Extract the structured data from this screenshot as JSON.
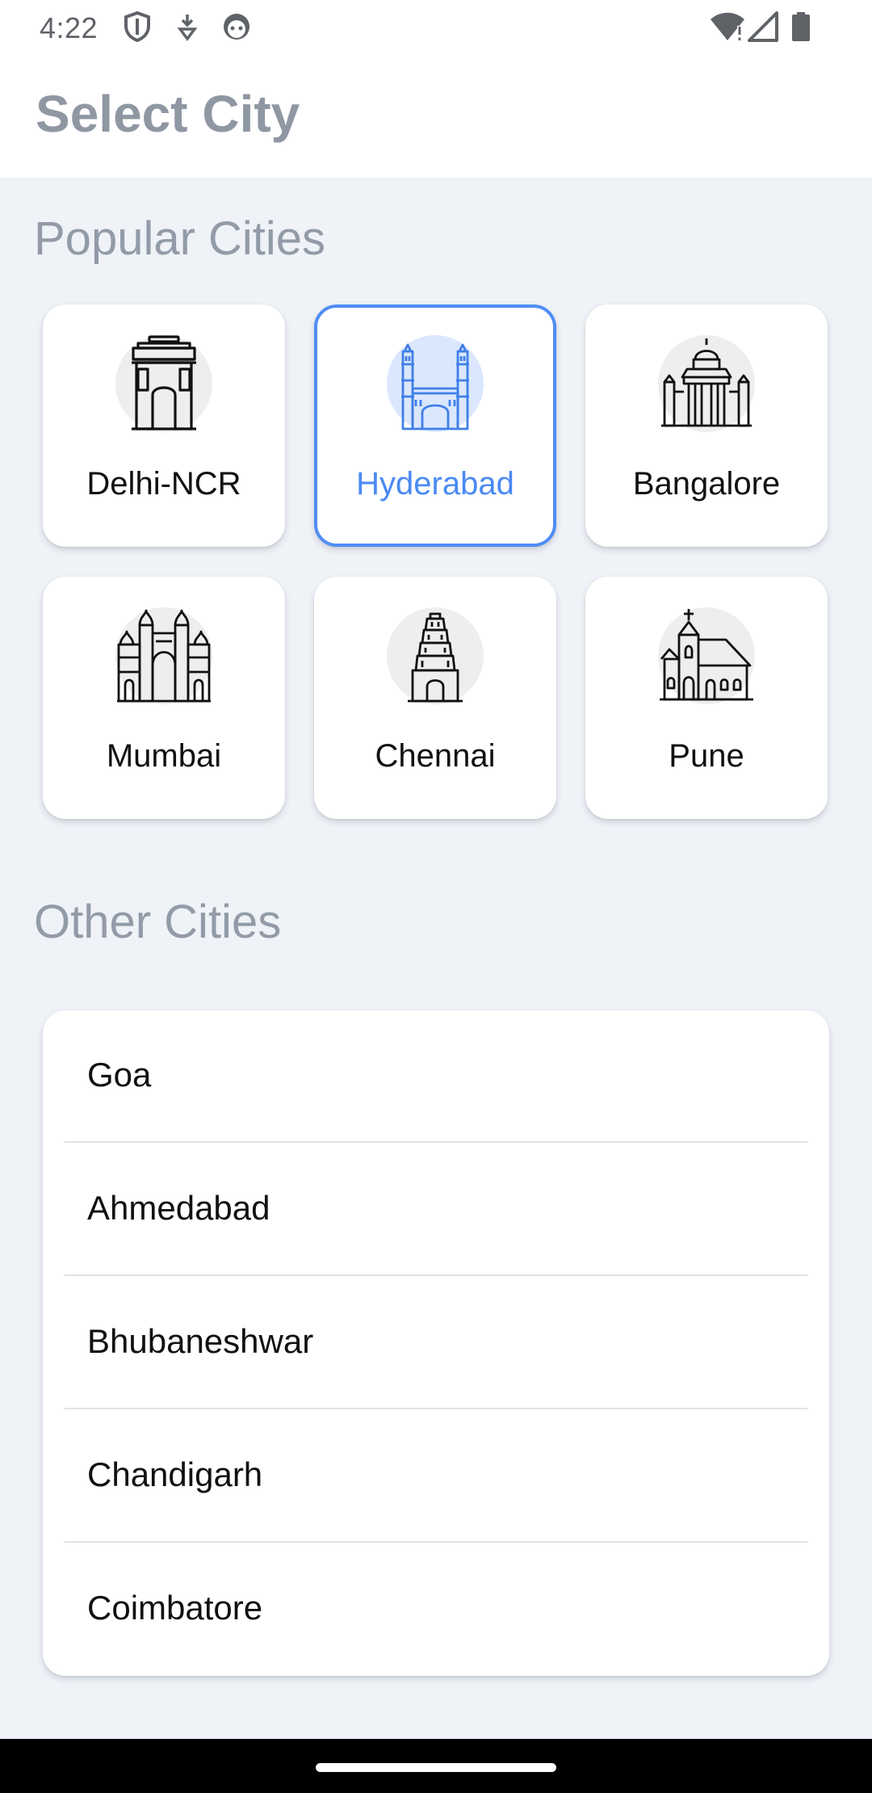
{
  "status_bar": {
    "time": "4:22",
    "left_icons": [
      "shield-icon",
      "download-icon",
      "face-icon"
    ],
    "right_icons": [
      "wifi-alert-icon",
      "signal-icon",
      "battery-icon"
    ]
  },
  "header": {
    "title": "Select City"
  },
  "popular": {
    "title": "Popular Cities",
    "cities": [
      {
        "label": "Delhi-NCR",
        "icon": "india-gate-icon",
        "selected": false
      },
      {
        "label": "Hyderabad",
        "icon": "charminar-icon",
        "selected": true
      },
      {
        "label": "Bangalore",
        "icon": "vidhana-soudha-icon",
        "selected": false
      },
      {
        "label": "Mumbai",
        "icon": "gateway-of-india-icon",
        "selected": false
      },
      {
        "label": "Chennai",
        "icon": "temple-gopuram-icon",
        "selected": false
      },
      {
        "label": "Pune",
        "icon": "church-icon",
        "selected": false
      }
    ]
  },
  "other": {
    "title": "Other Cities",
    "cities": [
      "Goa",
      "Ahmedabad",
      "Bhubaneshwar",
      "Chandigarh",
      "Coimbatore"
    ]
  },
  "colors": {
    "accent": "#4a8af4",
    "selected_icon_bg": "#dbe7fd",
    "title_gray": "#8f97a3",
    "page_bg": "#eff2f7"
  }
}
